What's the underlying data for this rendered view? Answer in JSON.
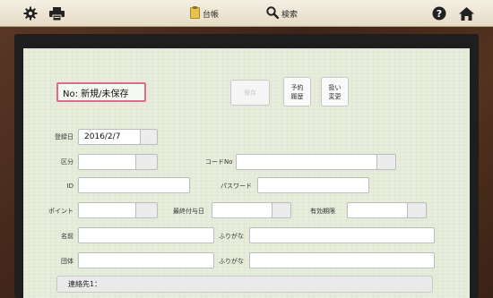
{
  "toolbar": {
    "ledger_label": "台帳",
    "search_label": "検索"
  },
  "record": {
    "number_text": "No: 新規/未保存"
  },
  "actions": {
    "save_label": "保存",
    "reservation_history_label_line1": "予約",
    "reservation_history_label_line2": "履歴",
    "handling_change_label_line1": "扱い",
    "handling_change_label_line2": "変更"
  },
  "form": {
    "registration_date_label": "登録日",
    "registration_date_value": "2016/2/7",
    "category_label": "区分",
    "category_value": "",
    "code_label": "コードNo",
    "code_value": "",
    "id_label": "ID",
    "id_value": "",
    "password_label": "パスワード",
    "password_value": "",
    "points_label": "ポイント",
    "points_value": "",
    "last_grant_label": "最終付与日",
    "last_grant_value": "",
    "expiry_label": "有効期限",
    "expiry_value": "",
    "name_label": "名前",
    "name_value": "",
    "name_kana_label": "ふりがな",
    "name_kana_value": "",
    "group_label": "団体",
    "group_value": "",
    "group_kana_label": "ふりがな",
    "group_kana_value": "",
    "contact_section_label": "連絡先1："
  },
  "colors": {
    "board_bg": "#e4ecd9",
    "highlight_border": "#e06a8a",
    "toolbar_bg": "#ede5d2",
    "frame_wood": "#4a2e22"
  },
  "icons": [
    "gear-icon",
    "printer-icon",
    "clipboard-icon",
    "search-icon",
    "help-icon",
    "home-icon"
  ]
}
